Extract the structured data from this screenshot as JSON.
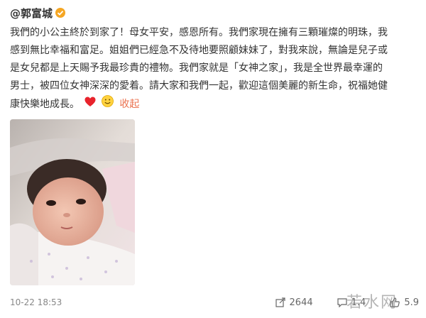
{
  "post": {
    "author_handle": "@郭富城",
    "verified_icon": "verified-badge-icon",
    "lines": [
      "我們的小公主終於到家了！母女平安，感恩所有。我們家現在擁有三顆璀燦的明珠，我",
      "感到無比幸福和富足。姐姐們已經急不及待地要照顧妹妹了，對我來說，無論是兒子或",
      "是女兒都是上天賜予我最珍貴的禮物。我們家就是「女神之家」，我是全世界最幸運的",
      "男士，被四位女神深深的愛着。請大家和我們一起，歡迎這個美麗的新生命，祝福她健",
      "康快樂地成長。"
    ],
    "emojis": [
      "heart-icon",
      "smile-icon"
    ],
    "collapse_label": "收起",
    "accent_color": "#eb7350",
    "photo_alt_icon": "newborn-baby-photo"
  },
  "footer": {
    "timestamp": "10-22 18:53",
    "share_count": "2644",
    "comment_count": "1.4",
    "like_count": "5.9",
    "watermark": "若水网"
  }
}
